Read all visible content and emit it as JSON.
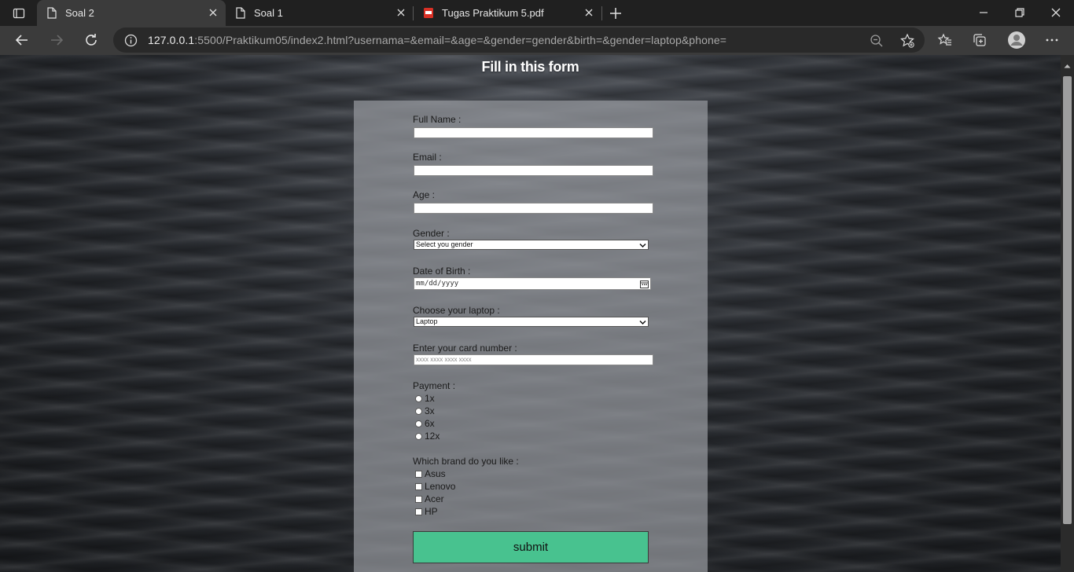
{
  "browser": {
    "tabs": [
      {
        "title": "Soal 2",
        "active": true,
        "icon": "page-icon"
      },
      {
        "title": "Soal 1",
        "active": false,
        "icon": "page-icon"
      },
      {
        "title": "Tugas Praktikum 5.pdf",
        "active": false,
        "icon": "pdf-icon"
      }
    ],
    "url_host": "127.0.0.1",
    "url_rest": ":5500/Praktikum05/index2.html?usernama=&email=&age=&gender=gender&birth=&gender=laptop&phone="
  },
  "page": {
    "title": "Fill in this form",
    "fields": {
      "fullname_label": "Full Name :",
      "email_label": "Email :",
      "age_label": "Age :",
      "gender_label": "Gender :",
      "gender_selected": "Select you gender",
      "birth_label": "Date of Birth :",
      "birth_placeholder": "mm/dd/yyyy",
      "laptop_label": "Choose your laptop :",
      "laptop_selected": "Laptop",
      "card_label": "Enter your card number :",
      "card_placeholder": "xxxx xxxx xxxx xxxx",
      "payment_label": "Payment :",
      "payment_options": [
        "1x",
        "3x",
        "6x",
        "12x"
      ],
      "brand_label": "Which brand do you like :",
      "brand_options": [
        "Asus",
        "Lenovo",
        "Acer",
        "HP"
      ]
    },
    "submit_label": "submit",
    "submit_color": "#48c28f"
  }
}
